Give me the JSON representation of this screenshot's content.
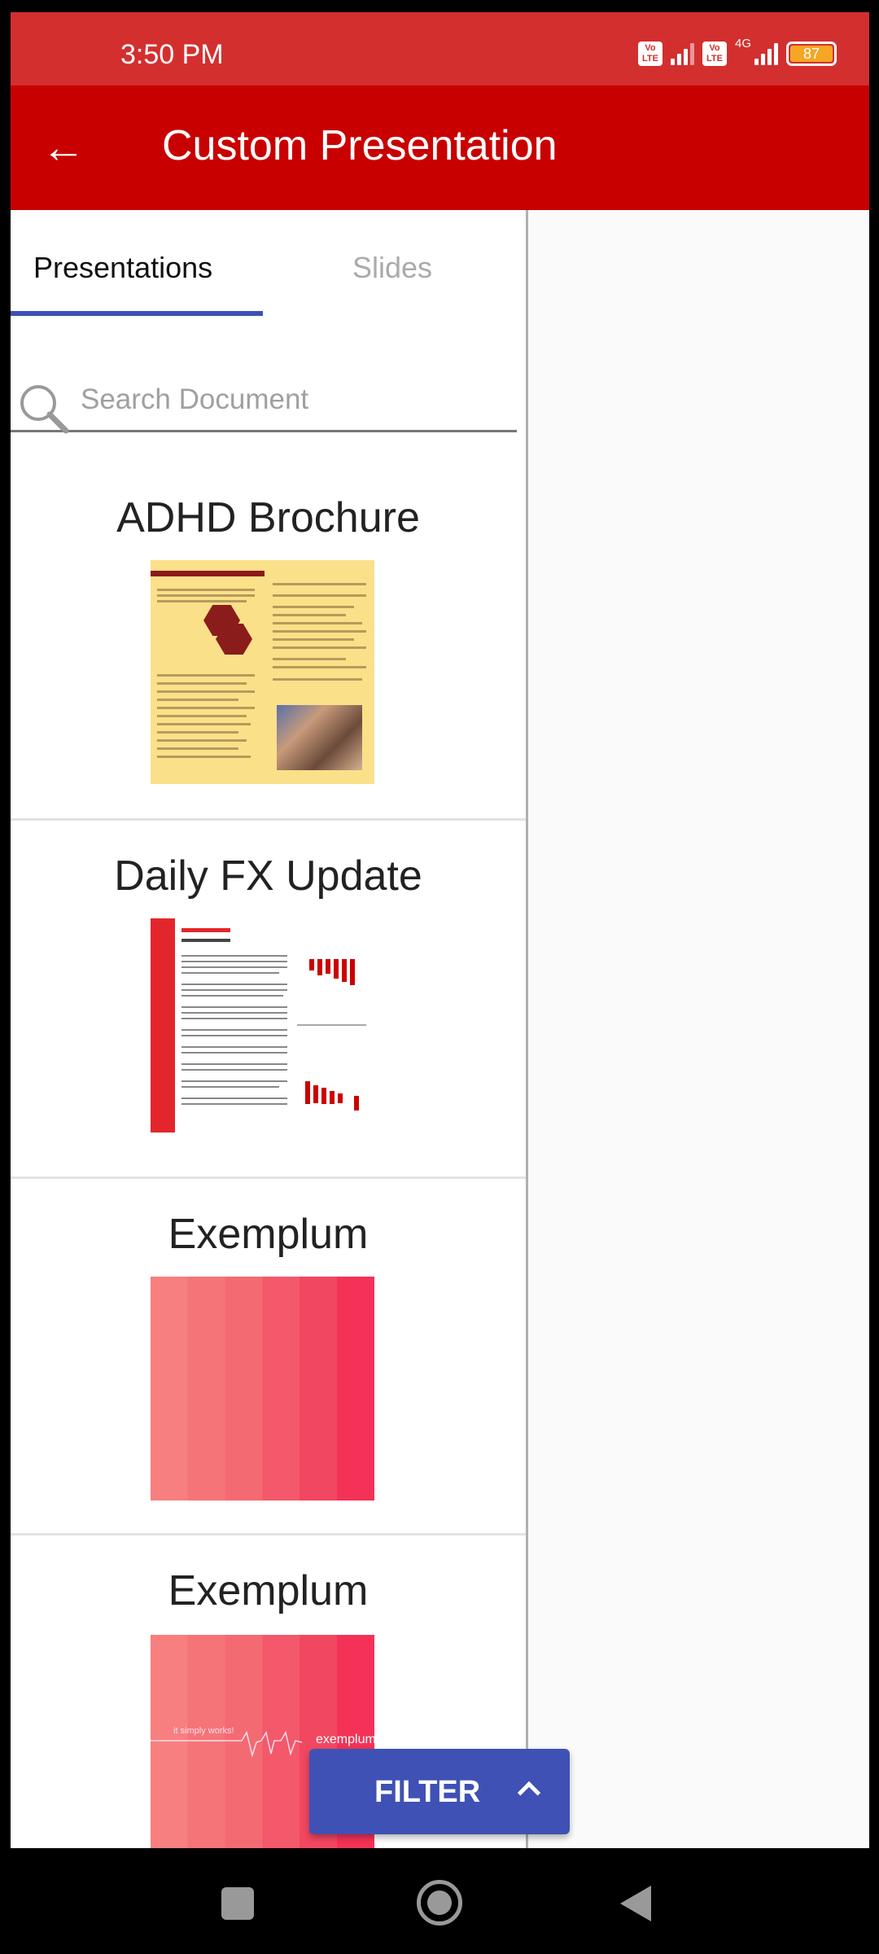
{
  "status_bar": {
    "time": "3:50 PM",
    "volte1": "Vo LTE",
    "volte2": "Vo LTE",
    "network": "4G",
    "battery": "87"
  },
  "app_bar": {
    "title": "Custom Presentation",
    "back_icon": "arrow-left-icon"
  },
  "tabs": [
    {
      "label": "Presentations",
      "selected": true
    },
    {
      "label": "Slides",
      "selected": false
    }
  ],
  "search": {
    "placeholder": "Search Document",
    "value": ""
  },
  "documents": [
    {
      "title": "ADHD Brochure"
    },
    {
      "title": "Daily FX Update"
    },
    {
      "title": "Exemplum"
    },
    {
      "title": "Exemplum",
      "thumb_tagline": "it simply works!",
      "thumb_logo": "exemplum"
    }
  ],
  "filter_button": {
    "label": "FILTER",
    "icon": "chevron-up-icon"
  },
  "colors": {
    "status_bar": "#d32f2f",
    "app_bar": "#c80000",
    "accent": "#3f51b5"
  }
}
